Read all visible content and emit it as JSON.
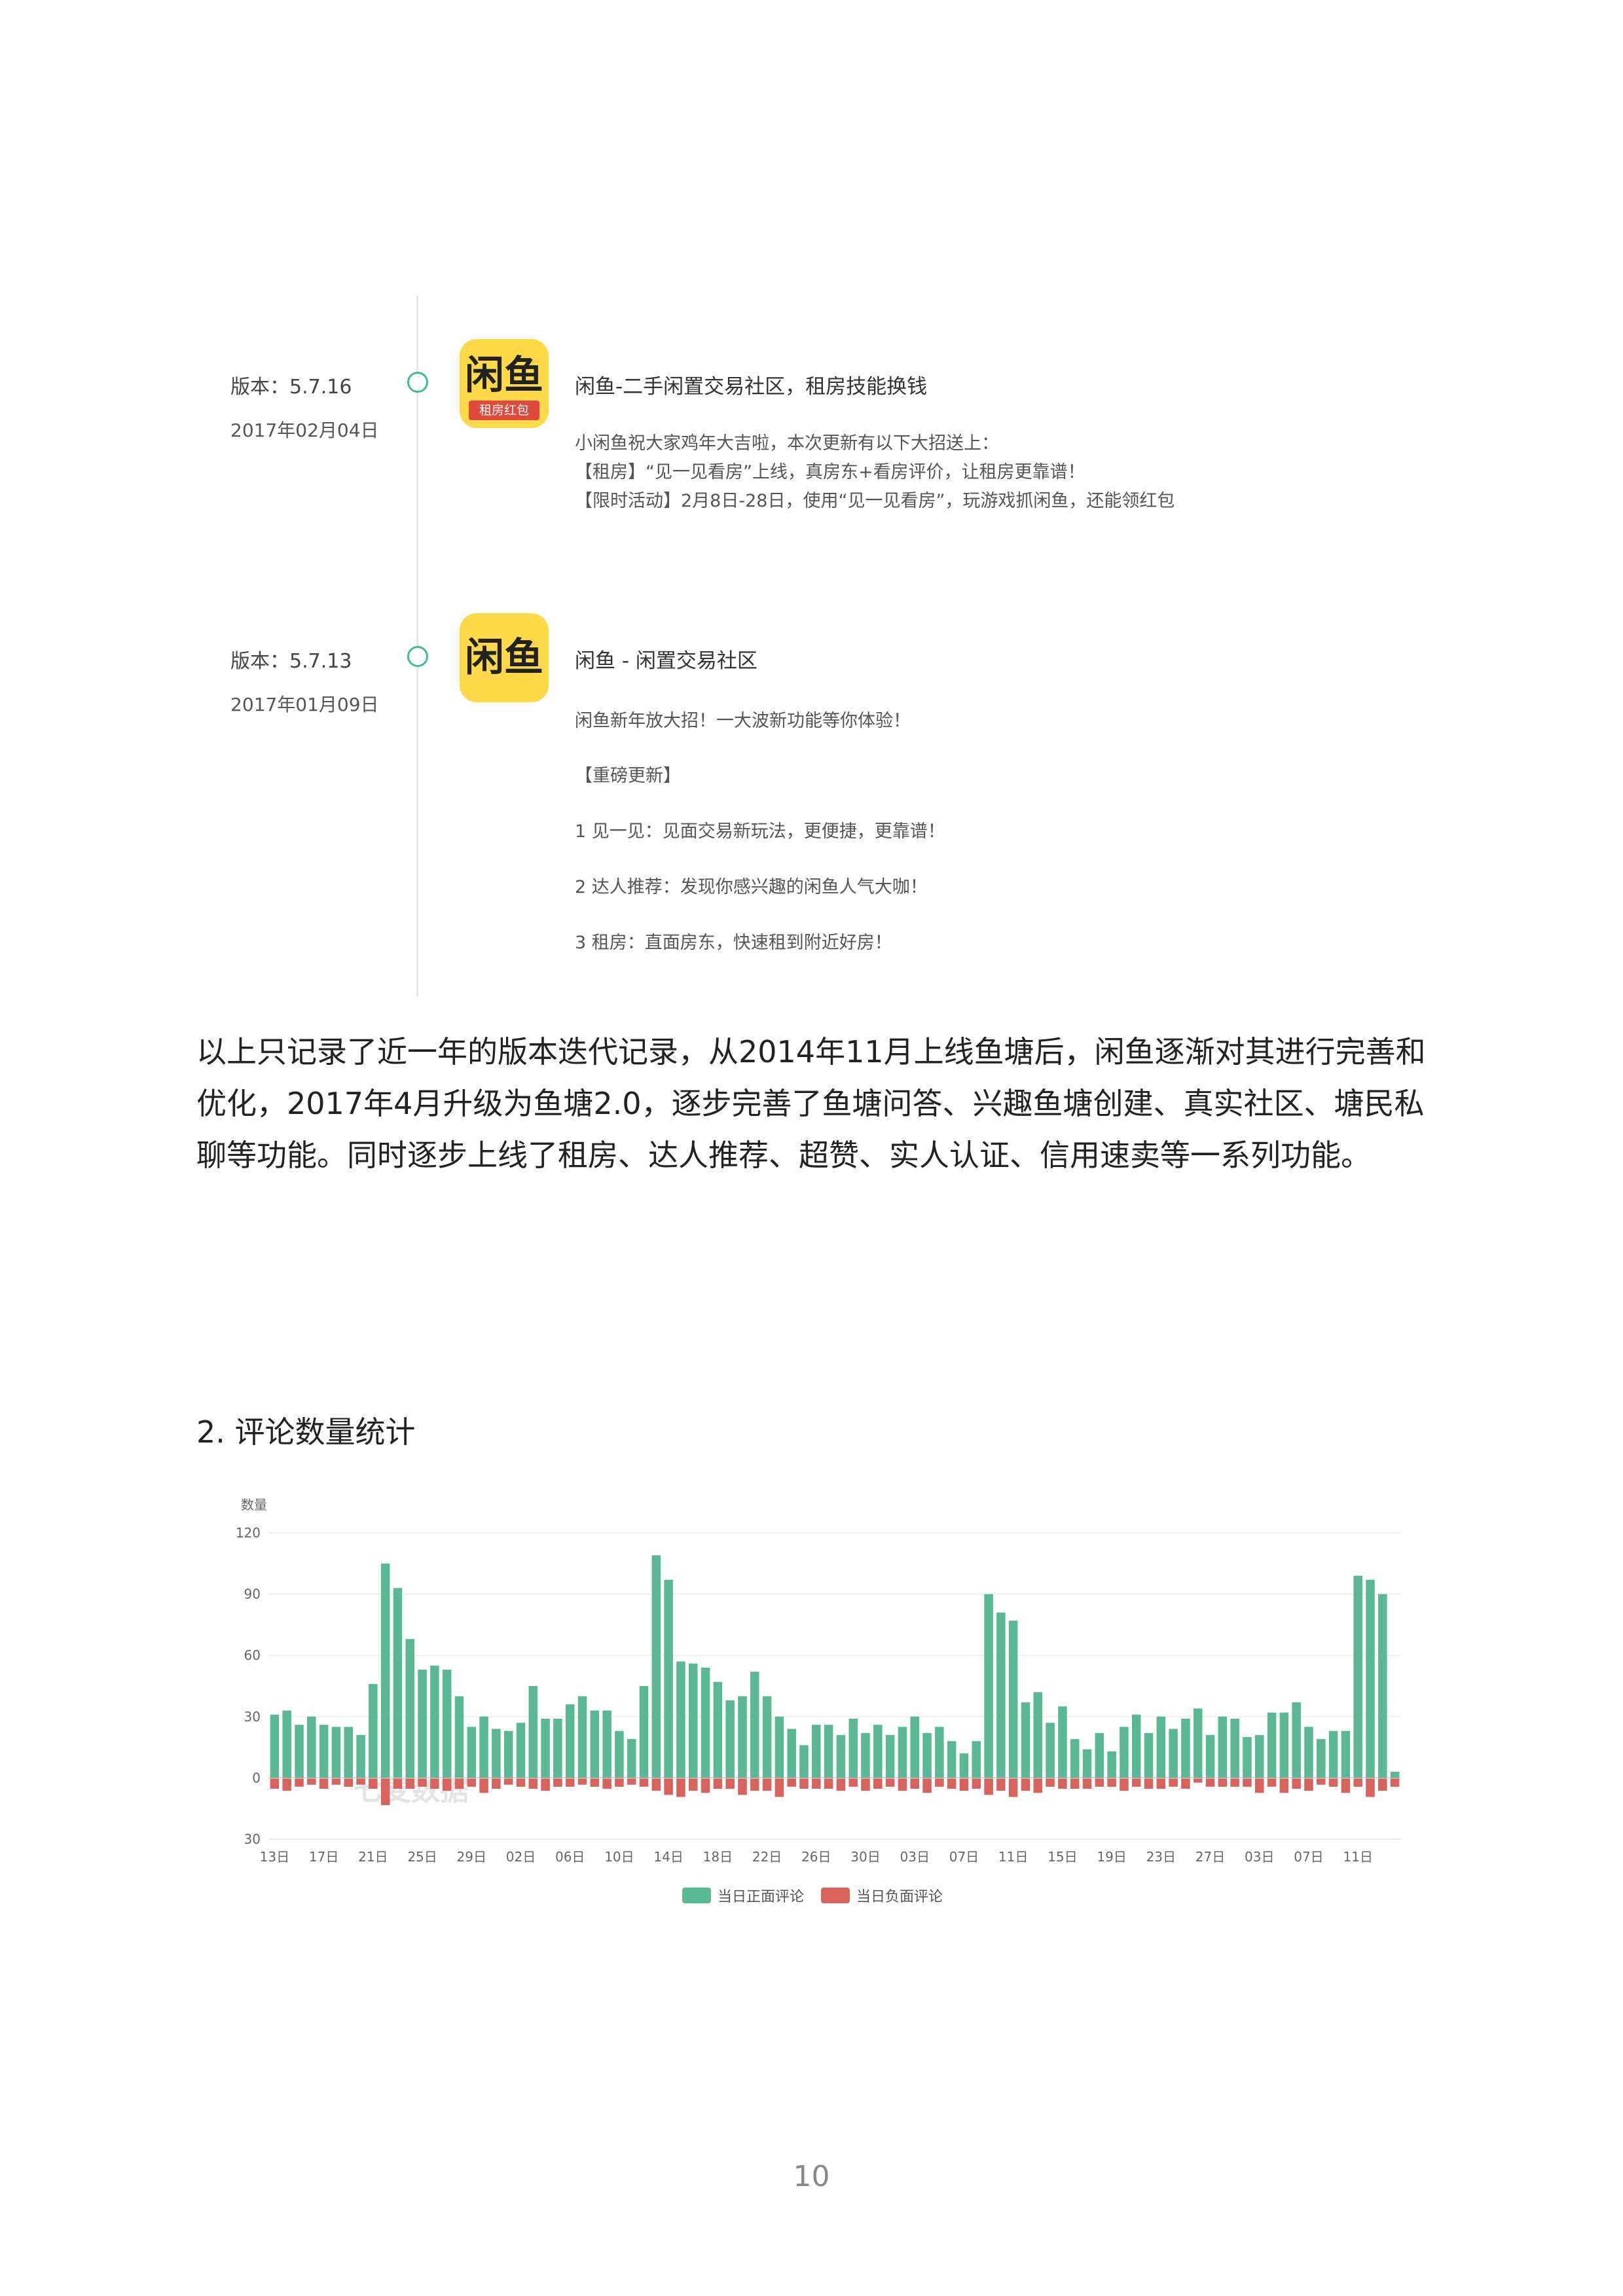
{
  "timeline": {
    "entries": [
      {
        "version": "版本：5.7.16",
        "date": "2017年02月04日",
        "icon_text": "闲鱼",
        "icon_ribbon": "租房红包",
        "app_title": "闲鱼-二手闲置交易社区，租房技能换钱",
        "notes": [
          "小闲鱼祝大家鸡年大吉啦，本次更新有以下大招送上：",
          "【租房】“见一见看房”上线，真房东+看房评价，让租房更靠谱！",
          "【限时活动】2月8日-28日，使用“见一见看房”，玩游戏抓闲鱼，还能领红包"
        ]
      },
      {
        "version": "版本：5.7.13",
        "date": "2017年01月09日",
        "icon_text": "闲鱼",
        "app_title": "闲鱼 - 闲置交易社区",
        "notes": [
          "闲鱼新年放大招！一大波新功能等你体验！",
          "【重磅更新】",
          "1 见一见：见面交易新玩法，更便捷，更靠谱！",
          "2 达人推荐：发现你感兴趣的闲鱼人气大咖！",
          "3 租房：直面房东，快速租到附近好房！"
        ]
      }
    ]
  },
  "paragraph": "以上只记录了近一年的版本迭代记录，从2014年11月上线鱼塘后，闲鱼逐渐对其进行完善和优化，2017年4月升级为鱼塘2.0，逐步完善了鱼塘问答、兴趣鱼塘创建、真实社区、塘民私聊等功能。同时逐步上线了租房、达人推荐、超赞、实人认证、信用速卖等一系列功能。",
  "section_heading": "2.   评论数量统计",
  "page_number": "10",
  "colors": {
    "positive": "#5ab895",
    "negative": "#d9625d",
    "dot": "#3cbf8a",
    "icon_bg": "#ffd948"
  },
  "chart_data": {
    "type": "bar",
    "ylabel": "数量",
    "yticks": [
      "120",
      "90",
      "60",
      "30",
      "0",
      "30"
    ],
    "ylim": [
      -30,
      120
    ],
    "x_tick_labels": [
      "13日",
      "17日",
      "21日",
      "25日",
      "29日",
      "02日",
      "06日",
      "10日",
      "14日",
      "18日",
      "22日",
      "26日",
      "30日",
      "03日",
      "07日",
      "11日",
      "15日",
      "19日",
      "23日",
      "27日",
      "03日",
      "07日",
      "11日"
    ],
    "x_tick_every": 4,
    "watermark": "七麦数据",
    "grid": true,
    "legend_position": "bottom",
    "series": [
      {
        "name": "当日正面评论",
        "color": "#5ab895",
        "values": [
          31,
          33,
          26,
          30,
          26,
          25,
          25,
          21,
          46,
          105,
          93,
          68,
          53,
          55,
          53,
          40,
          25,
          30,
          24,
          23,
          27,
          45,
          29,
          29,
          36,
          40,
          33,
          33,
          23,
          19,
          45,
          109,
          97,
          57,
          56,
          54,
          47,
          38,
          40,
          52,
          40,
          30,
          24,
          16,
          26,
          26,
          21,
          29,
          22,
          26,
          21,
          25,
          30,
          22,
          25,
          18,
          12,
          18,
          90,
          81,
          77,
          37,
          42,
          27,
          35,
          19,
          14,
          22,
          13,
          25,
          31,
          22,
          30,
          24,
          29,
          34,
          21,
          30,
          29,
          20,
          21,
          32,
          32,
          37,
          25,
          19,
          23,
          23,
          99,
          97,
          90,
          3
        ],
        "negative_values": [
          5,
          6,
          4,
          3,
          5,
          3,
          4,
          3,
          5,
          13,
          5,
          5,
          4,
          5,
          6,
          5,
          4,
          7,
          5,
          3,
          4,
          5,
          6,
          4,
          4,
          3,
          4,
          5,
          4,
          3,
          4,
          6,
          8,
          9,
          6,
          7,
          5,
          5,
          8,
          6,
          6,
          9,
          4,
          5,
          5,
          5,
          6,
          4,
          6,
          5,
          4,
          6,
          5,
          7,
          4,
          5,
          6,
          5,
          8,
          6,
          9,
          6,
          7,
          4,
          5,
          5,
          5,
          4,
          4,
          6,
          4,
          5,
          5,
          4,
          5,
          2,
          4,
          4,
          4,
          4,
          7,
          4,
          7,
          5,
          6,
          3,
          4,
          7,
          4,
          9,
          6,
          4
        ]
      },
      {
        "name": "当日负面评论",
        "color": "#d9625d"
      }
    ]
  }
}
